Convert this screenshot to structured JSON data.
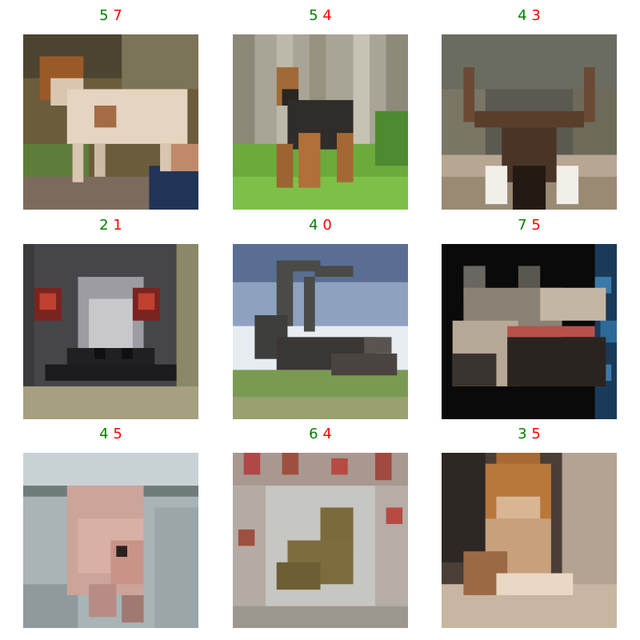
{
  "grid": {
    "tiles": [
      {
        "pred": "5",
        "label": "7",
        "image": "dog-photo"
      },
      {
        "pred": "5",
        "label": "4",
        "image": "dog-photo"
      },
      {
        "pred": "4",
        "label": "3",
        "image": "deer-photo"
      },
      {
        "pred": "2",
        "label": "1",
        "image": "ostrich-photo"
      },
      {
        "pred": "4",
        "label": "0",
        "image": "deer-photo"
      },
      {
        "pred": "7",
        "label": "5",
        "image": "horse-photo"
      },
      {
        "pred": "4",
        "label": "5",
        "image": "pig-photo"
      },
      {
        "pred": "6",
        "label": "4",
        "image": "frog-photo"
      },
      {
        "pred": "3",
        "label": "5",
        "image": "dog-photo"
      }
    ]
  },
  "colors": {
    "pred": "#008000",
    "label": "#ff0000"
  }
}
